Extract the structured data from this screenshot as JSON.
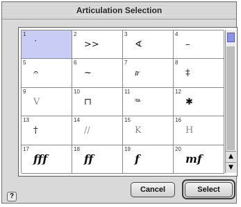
{
  "dialog": {
    "title": "Articulation Selection",
    "help_glyph": "?",
    "cancel_label": "Cancel",
    "select_label": "Select"
  },
  "grid": {
    "selected": "1",
    "cells": [
      {
        "num": "1",
        "sym": "˙",
        "style": "normal"
      },
      {
        "num": "2",
        "sym": ">>",
        "style": "normal"
      },
      {
        "num": "3",
        "sym": "∢",
        "style": "normal"
      },
      {
        "num": "4",
        "sym": "–",
        "style": "normal"
      },
      {
        "num": "5",
        "sym": "𝄐",
        "style": "normal"
      },
      {
        "num": "6",
        "sym": "~",
        "style": "normal"
      },
      {
        "num": "7",
        "sym": "𝆖",
        "style": "normal"
      },
      {
        "num": "8",
        "sym": "‡",
        "style": "normal"
      },
      {
        "num": "9",
        "sym": "V",
        "style": "light"
      },
      {
        "num": "10",
        "sym": "⊓",
        "style": "normal"
      },
      {
        "num": "11",
        "sym": "𝆮",
        "style": "normal"
      },
      {
        "num": "12",
        "sym": "✱",
        "style": "normal"
      },
      {
        "num": "13",
        "sym": "†",
        "style": "normal"
      },
      {
        "num": "14",
        "sym": "//",
        "style": "light"
      },
      {
        "num": "15",
        "sym": "K",
        "style": "light"
      },
      {
        "num": "16",
        "sym": "H",
        "style": "light"
      },
      {
        "num": "17",
        "sym": "fff",
        "style": "dyn"
      },
      {
        "num": "18",
        "sym": "ff",
        "style": "dyn"
      },
      {
        "num": "19",
        "sym": "f",
        "style": "dyn"
      },
      {
        "num": "20",
        "sym": "mf",
        "style": "dyn"
      }
    ]
  }
}
